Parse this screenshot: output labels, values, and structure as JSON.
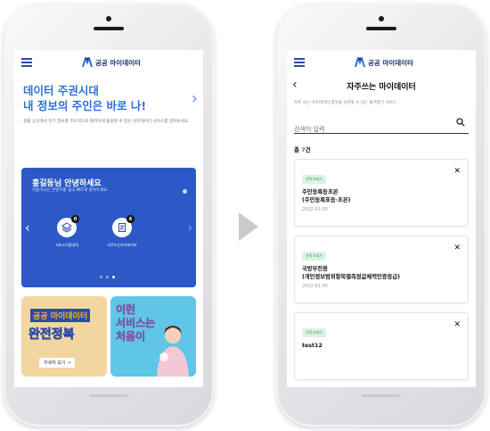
{
  "brand": {
    "name": "공공 마이데이터",
    "accent": "#2d6fe0",
    "navy": "#1c2f6e"
  },
  "left_screen": {
    "hero": {
      "line1": "데이터 주권시대",
      "line2": "내 정보의 주인은 바로 나!",
      "desc": "생활 곳곳에서 자기 정보를 주도적으로 편리하게 활용할 수 있는 마이데이터 서비스를 알아보세요."
    },
    "card": {
      "greeting": "홍길동님 안녕하세요",
      "subtitle": "이용하시는 콘텐츠를 쉽고 빠르게 알아두세요.",
      "services": [
        {
          "label": "서비스이용내역",
          "badge": "0",
          "icon": "layers-icon"
        },
        {
          "label": "자주쓰는마이데이터",
          "badge": "6",
          "icon": "document-icon"
        }
      ],
      "pager": {
        "count": 3,
        "active": 2
      }
    },
    "tiles": [
      {
        "line1": "공공 마이데이터",
        "line2": "완전정복",
        "button": "자세히 보기 →"
      },
      {
        "line1": "이런",
        "line2": "서비스는",
        "line3": "처음이"
      }
    ]
  },
  "right_screen": {
    "title": "자주쓰는 마이데이터",
    "help": "자주 쓰는 마이데이터 항목을 보관할 수 있는 즐겨찾기 서비스",
    "search_placeholder": "검색어 입력",
    "total_prefix": "총",
    "total_count": "7",
    "total_suffix": "건",
    "items": [
      {
        "tag": "선택 보내기",
        "title_l1": "주민등록등초본",
        "title_l2": "(주민등록표등·초본)",
        "date": "2022-01-05"
      },
      {
        "tag": "선택 보내기",
        "title_l1": "국방부전용",
        "title_l2": "(개인정보범위항목별측정값체력인증등급)",
        "date": "2022-01-05"
      },
      {
        "tag": "선택 보내기",
        "title_l1": "test12",
        "title_l2": "",
        "date": ""
      }
    ]
  }
}
